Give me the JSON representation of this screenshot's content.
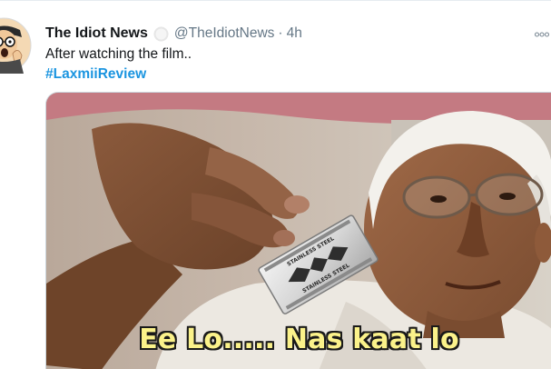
{
  "tweet": {
    "author_name": "The Idiot News",
    "handle": "@TheIdiotNews",
    "separator": "·",
    "time": "4h",
    "text": "After watching the film..",
    "hashtag": "#LaxmiiReview"
  },
  "media": {
    "caption": "Ee Lo..... Nas kaat lo",
    "blade_text_1": "STAINLESS STEEL",
    "blade_text_2": "STAINLESS STEEL"
  },
  "colors": {
    "link": "#1b95e0",
    "secondary_text": "#657786",
    "caption_fill": "#fbf28a"
  },
  "icons": {
    "verified": "verified-badge-icon",
    "more": "more-options-icon"
  }
}
